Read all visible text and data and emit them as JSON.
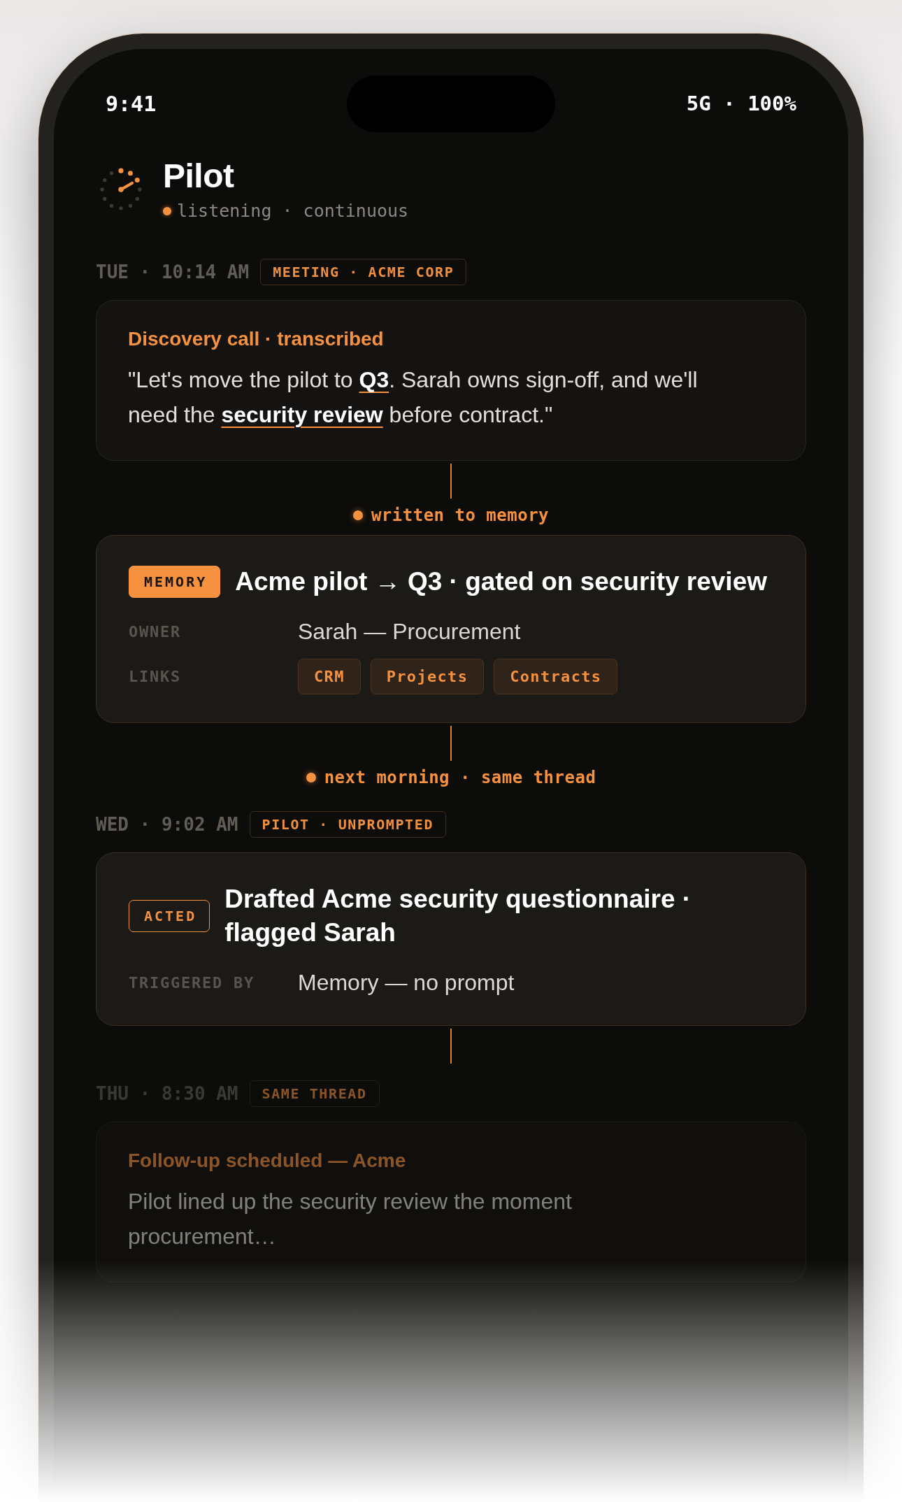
{
  "status_bar": {
    "time": "9:41",
    "indicators": "5G · 100%"
  },
  "header": {
    "title": "Pilot",
    "status": "listening · continuous"
  },
  "timeline": [
    {
      "kind": "stamp",
      "faded": false,
      "time": "TUE · 10:14 AM",
      "tag": "MEETING · ACME CORP"
    },
    {
      "kind": "note",
      "faded": false,
      "title": "Discovery call · transcribed",
      "body_lines": [
        "\"Let's move the pilot to **Q3**. Sarah owns sign-off, and we'll",
        "need the **security review** before contract.\""
      ]
    },
    {
      "kind": "connector",
      "faded": false,
      "label": "written to memory"
    },
    {
      "kind": "record",
      "faded": false,
      "badge": {
        "kind": "solid",
        "label": "MEMORY"
      },
      "title": "Acme pilot → Q3 · gated on security review",
      "fields": [
        {
          "kind": "text",
          "label": "OWNER",
          "value": "Sarah — Procurement"
        },
        {
          "kind": "links",
          "label": "LINKS",
          "links": [
            "CRM",
            "Projects",
            "Contracts"
          ]
        }
      ]
    },
    {
      "kind": "connector",
      "faded": false,
      "label": "next morning · same thread"
    },
    {
      "kind": "stamp",
      "faded": false,
      "time": "WED · 9:02 AM",
      "tag": "PILOT · UNPROMPTED"
    },
    {
      "kind": "record",
      "faded": false,
      "badge": {
        "kind": "outline",
        "label": "ACTED"
      },
      "title": "Drafted Acme security questionnaire · flagged Sarah",
      "fields": [
        {
          "kind": "text",
          "label": "TRIGGERED BY",
          "value": "Memory — no prompt"
        }
      ]
    },
    {
      "kind": "connector",
      "faded": false
    },
    {
      "kind": "stamp",
      "faded": true,
      "time": "THU · 8:30 AM",
      "tag": "SAME THREAD"
    },
    {
      "kind": "note",
      "faded": true,
      "title": "Follow-up scheduled — Acme",
      "body_lines": [
        "Pilot lined up the security review the moment",
        "procurement…"
      ]
    }
  ]
}
